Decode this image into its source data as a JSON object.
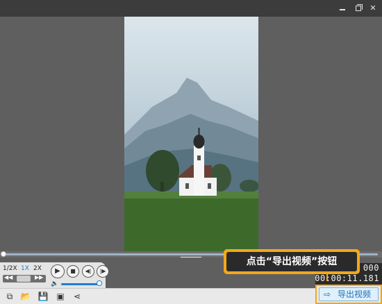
{
  "window": {
    "minimize_icon": "minimize-icon",
    "maximize_icon": "restore-icon",
    "close_label": "✕"
  },
  "player": {
    "speed_options": [
      "1/2X",
      "1X",
      "2X"
    ],
    "selected_speed": "1X",
    "time_current": "00:0",
    "time_total": "00:00:11.181",
    "time_top_suffix": "000",
    "progress_fraction": 0.0,
    "volume_fraction": 0.85
  },
  "callout": {
    "text": "点击“导出视频”按钮"
  },
  "toolbar": {
    "icons": [
      "crop-icon",
      "folder-open-icon",
      "save-icon",
      "save-as-icon",
      "share-icon"
    ],
    "export_label": "导出视频"
  },
  "colors": {
    "accent": "#1d7fd1",
    "highlight": "#f2a81d",
    "background": "#5f5f5f"
  }
}
